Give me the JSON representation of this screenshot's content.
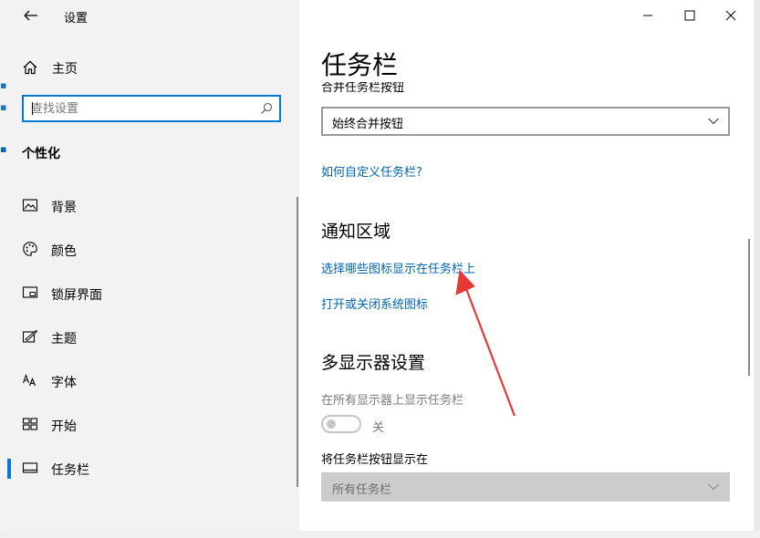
{
  "window": {
    "title": "设置",
    "controls": {
      "minimize": "minimize",
      "maximize": "maximize",
      "close": "close"
    }
  },
  "sidebar": {
    "home_label": "主页",
    "search_placeholder": "查找设置",
    "section_title": "个性化",
    "items": [
      {
        "label": "背景",
        "icon": "image-icon",
        "selected": false
      },
      {
        "label": "颜色",
        "icon": "palette-icon",
        "selected": false
      },
      {
        "label": "锁屏界面",
        "icon": "lock-screen-icon",
        "selected": false
      },
      {
        "label": "主题",
        "icon": "theme-icon",
        "selected": false
      },
      {
        "label": "字体",
        "icon": "font-icon",
        "selected": false
      },
      {
        "label": "开始",
        "icon": "start-icon",
        "selected": false
      },
      {
        "label": "任务栏",
        "icon": "taskbar-icon",
        "selected": true
      }
    ]
  },
  "main": {
    "title": "任务栏",
    "combine_label": "合并任务栏按钮",
    "combine_value": "始终合并按钮",
    "customize_link": "如何自定义任务栏?",
    "notification_title": "通知区域",
    "select_icons_link": "选择哪些图标显示在任务栏上",
    "system_icons_link": "打开或关闭系统图标",
    "multi_display_title": "多显示器设置",
    "show_all_displays_label": "在所有显示器上显示任务栏",
    "toggle_state": "关",
    "show_buttons_label": "将任务栏按钮显示在",
    "show_buttons_value": "所有任务栏"
  },
  "colors": {
    "accent": "#0078d7",
    "link": "#0063b1",
    "annotation_arrow": "#e53935"
  }
}
